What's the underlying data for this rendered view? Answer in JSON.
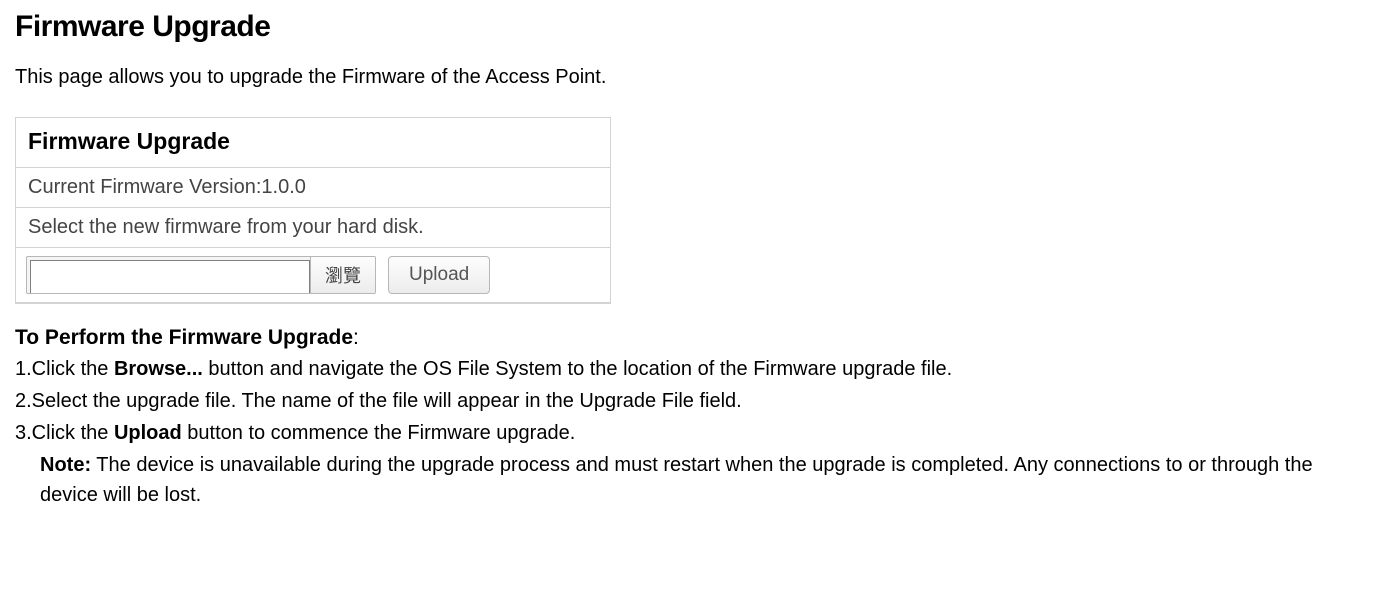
{
  "title": "Firmware Upgrade",
  "intro": "This page allows you to upgrade the Firmware of the Access Point.",
  "panel": {
    "header": "Firmware Upgrade",
    "version_label": "Current Firmware Version:",
    "version_value": "1.0.0",
    "select_text": "Select the new firmware from your hard disk.",
    "file_value": "",
    "browse_label": "瀏覽",
    "upload_label": "Upload"
  },
  "section": {
    "heading_bold": "To Perform the Firmware Upgrade",
    "heading_tail": ":"
  },
  "steps": {
    "s1_prefix": "1.Click the ",
    "s1_bold": "Browse...",
    "s1_suffix": " button and navigate the OS File System to the location of the Firmware upgrade file.",
    "s2": "2.Select the upgrade file. The name of the file will appear in the Upgrade File field.",
    "s3_prefix": "3.Click the ",
    "s3_bold": "Upload",
    "s3_suffix": " button to commence the Firmware upgrade.",
    "note_label": "Note:",
    "note_text": " The device is unavailable during the upgrade process and must restart when the upgrade is completed. Any connections to or through the device will be lost."
  }
}
